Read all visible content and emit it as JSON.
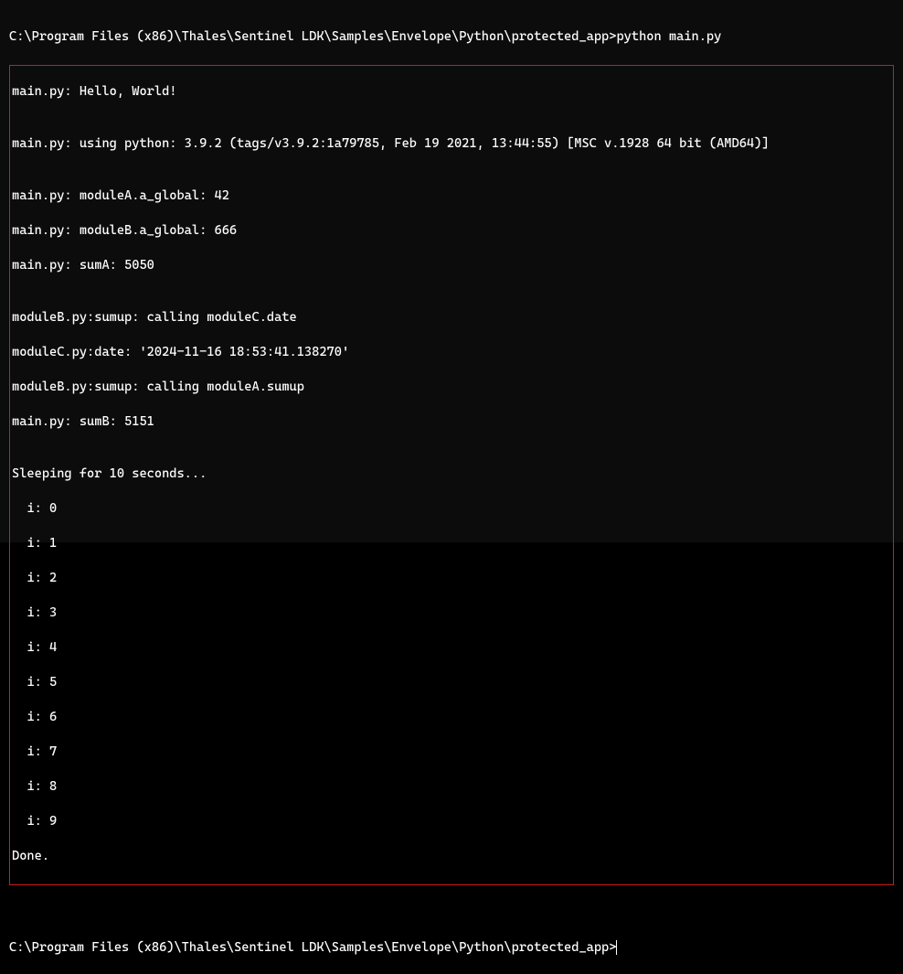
{
  "terminal": {
    "prompt1_path": "C:\\Program Files (x86)\\Thales\\Sentinel LDK\\Samples\\Envelope\\Python\\protected_app>",
    "prompt1_command": "python main.py",
    "output": {
      "line1": "main.py: Hello, World!",
      "line2": "",
      "line3": "main.py: using python: 3.9.2 (tags/v3.9.2:1a79785, Feb 19 2021, 13:44:55) [MSC v.1928 64 bit (AMD64)]",
      "line4": "",
      "line5": "main.py: moduleA.a_global: 42",
      "line6": "main.py: moduleB.a_global: 666",
      "line7": "main.py: sumA: 5050",
      "line8": "",
      "line9": "moduleB.py:sumup: calling moduleC.date",
      "line10": "moduleC.py:date: '2024-11-16 18:53:41.138270'",
      "line11": "moduleB.py:sumup: calling moduleA.sumup",
      "line12": "main.py: sumB: 5151",
      "line13": "",
      "line14": "Sleeping for 10 seconds...",
      "line15": "  i: 0",
      "line16": "  i: 1",
      "line17": "  i: 2",
      "line18": "  i: 3",
      "line19": "  i: 4",
      "line20": "  i: 5",
      "line21": "  i: 6",
      "line22": "  i: 7",
      "line23": "  i: 8",
      "line24": "  i: 9",
      "line25": "Done."
    },
    "prompt2_path": "C:\\Program Files (x86)\\Thales\\Sentinel LDK\\Samples\\Envelope\\Python\\protected_app>"
  }
}
